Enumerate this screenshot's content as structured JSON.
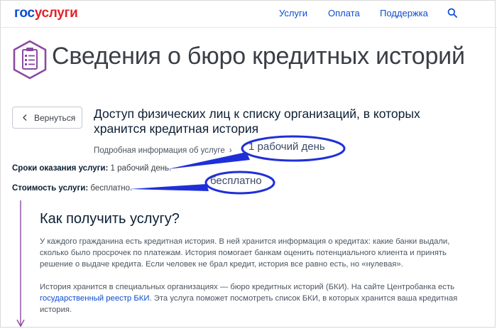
{
  "header": {
    "logo_part1": "гос",
    "logo_part2": "услуги",
    "nav": [
      "Услуги",
      "Оплата",
      "Поддержка"
    ]
  },
  "page": {
    "title": "Сведения о бюро кредитных историй",
    "back_label": "Вернуться",
    "service_title": "Доступ физических лиц к списку организаций, в которых хранится кредитная история",
    "more_info": "Подробная информация об услуге",
    "terms_label": "Сроки оказания услуги:",
    "terms_value": "1 рабочий день.",
    "cost_label": "Стоимость услуги:",
    "cost_value": "бесплатно."
  },
  "annotations": {
    "bubble_1": "1 рабочий день",
    "bubble_2": "бесплатно"
  },
  "section": {
    "title": "Как получить услугу?",
    "para1": "У каждого гражданина есть кредитная история. В ней хранится информация о кредитах: какие банки выдали, сколько было просрочек по платежам. История помогает банкам оценить потенциального клиента и принять решение о выдаче кредита. Если человек не брал кредит, история все равно есть, но «нулевая».",
    "para2_before": "История хранится в специальных организациях — бюро кредитных историй (БКИ). На сайте Центробанка есть ",
    "para2_link": "государственный реестр БКИ",
    "para2_after": ". Эта услуга поможет посмотреть список БКИ, в которых хранится ваша кредитная история."
  },
  "colors": {
    "brand_blue": "#0d4cd3",
    "brand_red": "#e4232a",
    "accent_purple": "#8a4aa0",
    "annotation_blue": "#1f2fd8"
  },
  "icons": {
    "search": "search-icon",
    "service": "clipboard-list-icon",
    "back": "chevron-left-icon",
    "more": "chevron-right-icon"
  }
}
